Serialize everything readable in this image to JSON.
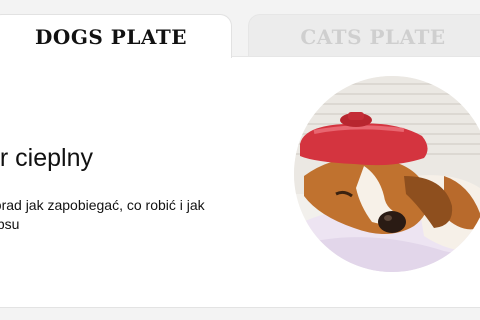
{
  "tabs": [
    {
      "label": "DOGS PLATE",
      "active": true
    },
    {
      "label": "CATS PLATE",
      "active": false
    }
  ],
  "article": {
    "title": "ar cieplny",
    "description": "porad jak zapobiegać, co robić i jak\nc psu"
  },
  "image": {
    "icon": "dog-with-ice-pack-photo"
  },
  "colors": {
    "active_tab_text": "#111111",
    "inactive_tab_text": "#cfcfcf",
    "ice_pack": "#d4343f"
  }
}
